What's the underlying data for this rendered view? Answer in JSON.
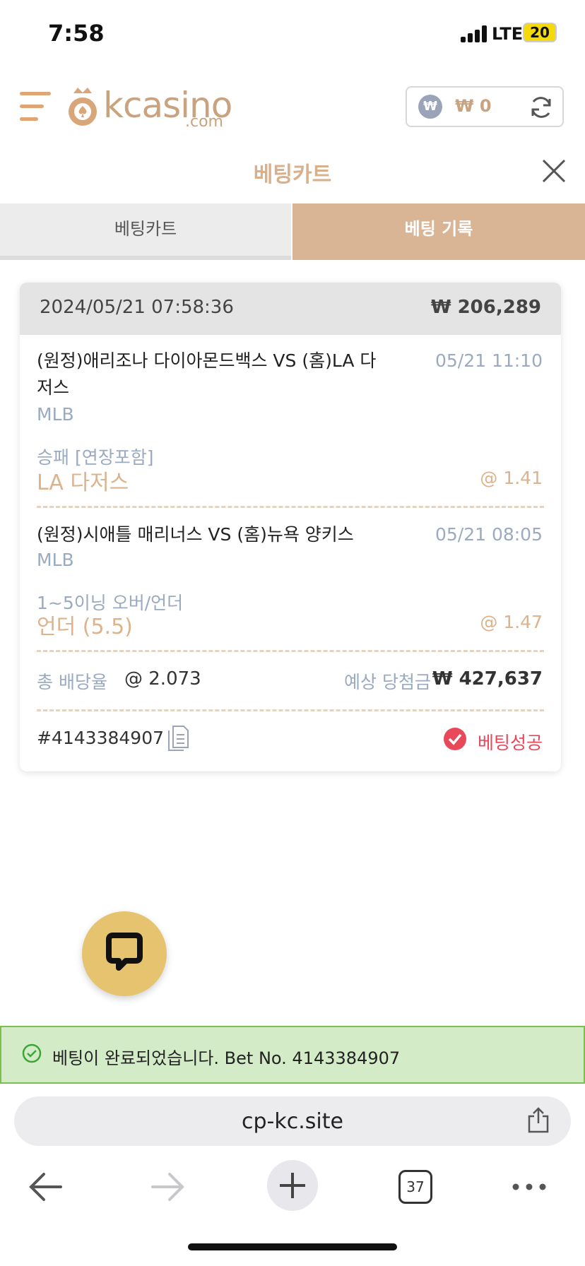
{
  "status_bar": {
    "time": "7:58",
    "network": "LTE",
    "battery": "20"
  },
  "header": {
    "logo_text": "kcasino",
    "logo_sub": ".com",
    "currency_symbol": "₩",
    "balance": "₩ 0"
  },
  "title": "베팅카트",
  "tabs": {
    "cart": "베팅카트",
    "history": "베팅 기록"
  },
  "bet": {
    "datetime": "2024/05/21 07:58:36",
    "amount": "₩ 206,289",
    "selections": [
      {
        "match_line1": "(원정)애리조나 다이아몬드백스 VS (홈)LA 다",
        "match_line2": "저스",
        "time": "05/21 11:10",
        "league": "MLB",
        "market": "승패 [연장포함]",
        "pick": "LA 다저스",
        "odds": "@ 1.41"
      },
      {
        "match_line1": "(원정)시애틀 매리너스 VS (홈)뉴욕 양키스",
        "time": "05/21 08:05",
        "league": "MLB",
        "market": "1~5이닝 오버/언더",
        "pick": "언더 (5.5)",
        "odds": "@ 1.47"
      }
    ],
    "total_odds_label": "총 배당율",
    "total_odds": "@ 2.073",
    "expected_win_label": "예상 당첨금",
    "expected_win": "₩ 427,637",
    "bet_number": "#4143384907",
    "status": "베팅성공"
  },
  "toast": {
    "message": "베팅이 완료되었습니다. Bet No. 4143384907"
  },
  "browser": {
    "url": "cp-kc.site",
    "tab_count": "37"
  },
  "colors": {
    "accent": "#d9b596",
    "success_red": "#e8485a",
    "toast_bg": "#d3ecc7"
  }
}
